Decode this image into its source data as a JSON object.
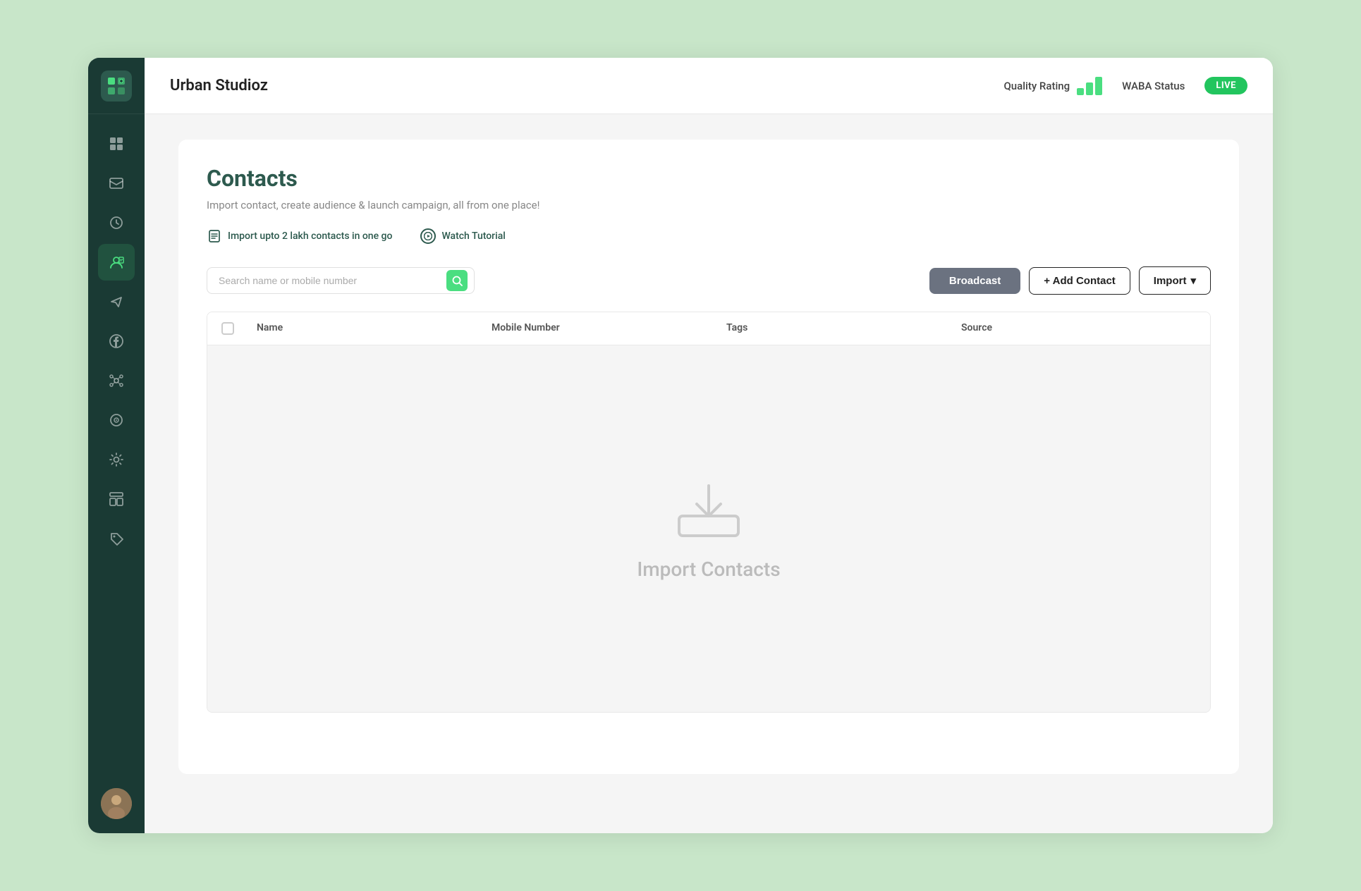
{
  "app": {
    "name": "Urban Studioz"
  },
  "header": {
    "title": "Urban Studioz",
    "quality_rating_label": "Quality Rating",
    "waba_label": "WABA Status",
    "live_badge": "LIVE"
  },
  "sidebar": {
    "items": [
      {
        "name": "dashboard",
        "icon": "⊞",
        "active": false
      },
      {
        "name": "inbox",
        "icon": "☰",
        "active": false
      },
      {
        "name": "history",
        "icon": "◷",
        "active": false
      },
      {
        "name": "contacts",
        "icon": "👤",
        "active": true
      },
      {
        "name": "campaigns",
        "icon": "✈",
        "active": false
      },
      {
        "name": "facebook",
        "icon": "f",
        "active": false
      },
      {
        "name": "integrations",
        "icon": "⬡",
        "active": false
      },
      {
        "name": "analytics",
        "icon": "◎",
        "active": false
      },
      {
        "name": "settings",
        "icon": "⚙",
        "active": false
      },
      {
        "name": "widgets",
        "icon": "⊟",
        "active": false
      },
      {
        "name": "tags",
        "icon": "◇",
        "active": false
      }
    ]
  },
  "page": {
    "title": "Contacts",
    "subtitle": "Import contact, create audience & launch campaign, all from one place!",
    "info_items": [
      {
        "text": "Import upto 2 lakh contacts in one go",
        "icon": "file"
      },
      {
        "text": "Watch Tutorial",
        "icon": "play"
      }
    ]
  },
  "toolbar": {
    "search_placeholder": "Search name or mobile number",
    "broadcast_label": "Broadcast",
    "add_contact_label": "+ Add Contact",
    "import_label": "Import",
    "import_chevron": "▾"
  },
  "table": {
    "columns": [
      {
        "key": "checkbox",
        "label": ""
      },
      {
        "key": "name",
        "label": "Name"
      },
      {
        "key": "mobile",
        "label": "Mobile Number"
      },
      {
        "key": "tags",
        "label": "Tags"
      },
      {
        "key": "source",
        "label": "Source"
      }
    ],
    "empty_state_text": "Import Contacts"
  }
}
